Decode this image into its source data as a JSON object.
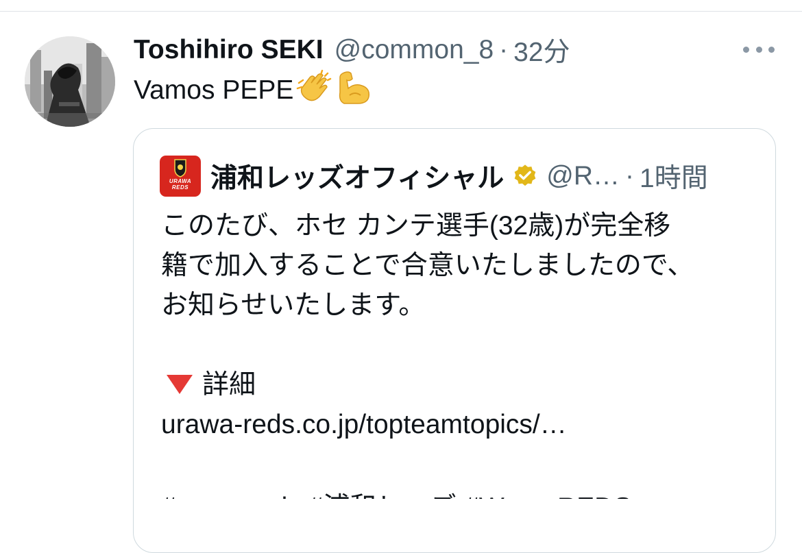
{
  "tweet": {
    "author_name": "Toshihiro SEKI",
    "author_handle": "@common_8",
    "separator": "·",
    "time": "32分",
    "text": "Vamos PEPE",
    "emojis": [
      "clapping-hands",
      "flexed-biceps"
    ]
  },
  "quote": {
    "avatar_text_line1": "URAWA",
    "avatar_text_line2": "REDS",
    "author_name": "浦和レッズオフィシャル",
    "verified": true,
    "author_handle": "@R…",
    "separator": "·",
    "time": "1時間",
    "lines": [
      "このたび、ホセ カンテ選手(32歳)が完全移",
      "籍で加入することで合意いたしましたので、",
      "お知らせいたします。"
    ],
    "detail_label": "詳細",
    "link": "urawa-reds.co.jp/topteamtopics/…",
    "cut_line": "#urawareds #浦和レッズ #WeareREDS"
  },
  "colors": {
    "text": "#0f1419",
    "secondary": "#536471",
    "border": "#cfd9de",
    "reds_red": "#d7261e",
    "verified_gold": "#e2b719"
  }
}
